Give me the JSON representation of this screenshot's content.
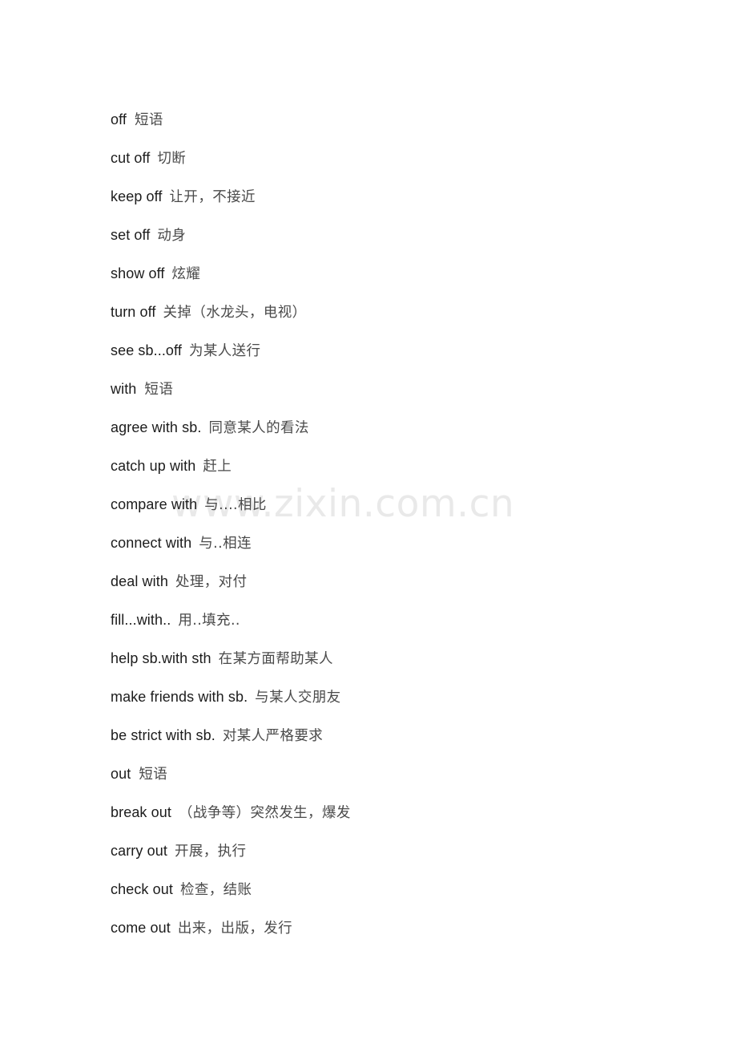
{
  "document": {
    "watermark": "www.zixin.com.cn",
    "text_color": "#1c1c1c",
    "gloss_color": "#4a4a4a",
    "watermark_color": "#e9e9e9",
    "background_color": "#ffffff"
  },
  "entries": [
    {
      "term": "off",
      "gloss": "短语",
      "section": true
    },
    {
      "term": "cut off",
      "gloss": "切断",
      "section": false
    },
    {
      "term": "keep off",
      "gloss": "让开，不接近",
      "section": false
    },
    {
      "term": "set off",
      "gloss": "动身",
      "section": false
    },
    {
      "term": "show off",
      "gloss": "炫耀",
      "section": false
    },
    {
      "term": "turn off",
      "gloss": "关掉（水龙头，电视）",
      "section": false
    },
    {
      "term": "see sb...off",
      "gloss": "为某人送行",
      "section": false
    },
    {
      "term": "with",
      "gloss": "短语",
      "section": true
    },
    {
      "term": "agree with sb.",
      "gloss": "同意某人的看法",
      "section": false
    },
    {
      "term": "catch up with",
      "gloss": "赶上",
      "section": false
    },
    {
      "term": "compare with",
      "gloss": "与....相比",
      "section": false
    },
    {
      "term": "connect with",
      "gloss": "与..相连",
      "section": false
    },
    {
      "term": "deal with",
      "gloss": "处理，对付",
      "section": false
    },
    {
      "term": "fill...with..",
      "gloss": "用..填充..",
      "section": false
    },
    {
      "term": "help sb.with sth",
      "gloss": "在某方面帮助某人",
      "section": false
    },
    {
      "term": "make friends with sb.",
      "gloss": "与某人交朋友",
      "section": false
    },
    {
      "term": "be strict with sb.",
      "gloss": "对某人严格要求",
      "section": false
    },
    {
      "term": "out",
      "gloss": "短语",
      "section": true
    },
    {
      "term": "break out",
      "gloss": "（战争等）突然发生，爆发",
      "section": false
    },
    {
      "term": "carry out",
      "gloss": "开展，执行",
      "section": false
    },
    {
      "term": "check out",
      "gloss": "检查，结账",
      "section": false
    },
    {
      "term": "come out",
      "gloss": "出来，出版，发行",
      "section": false
    }
  ]
}
